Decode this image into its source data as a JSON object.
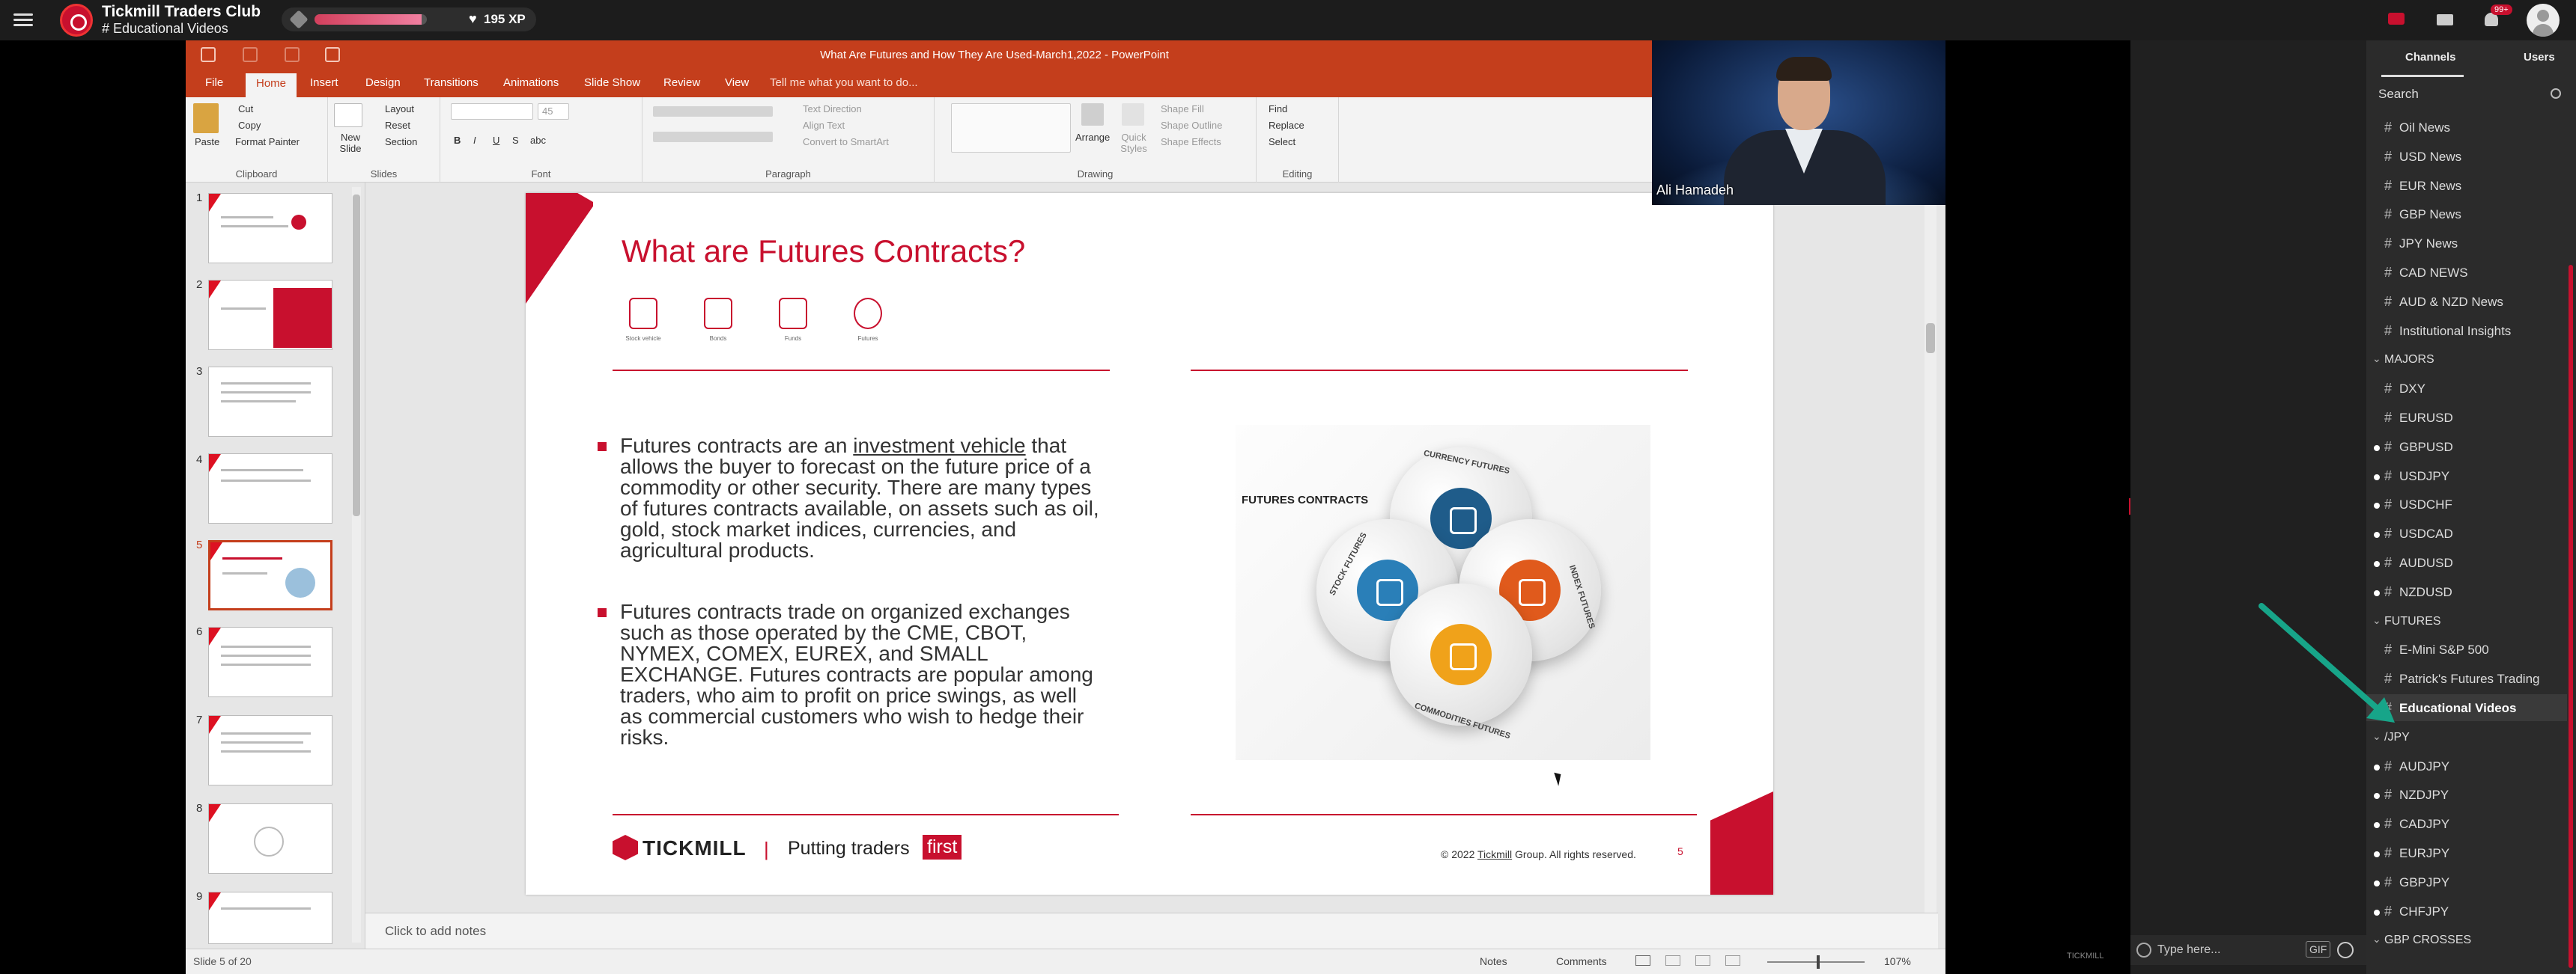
{
  "app": {
    "name": "Tickmill Traders Club",
    "current_channel": "# Educational Videos",
    "xp": "195 XP",
    "xp_progress": 0.95,
    "notification_count": "99+",
    "accent": "#c8102e"
  },
  "powerpoint": {
    "window_title": "What Are Futures and How They Are Used-March1,2022 - PowerPoint",
    "tabs": [
      "File",
      "Home",
      "Insert",
      "Design",
      "Transitions",
      "Animations",
      "Slide Show",
      "Review",
      "View"
    ],
    "tell_me": "Tell me what you want to do...",
    "ribbon": {
      "clipboard": {
        "label": "Clipboard",
        "paste": "Paste",
        "cut": "Cut",
        "copy": "Copy",
        "format_painter": "Format Painter"
      },
      "slides": {
        "label": "Slides",
        "new_slide": "New Slide",
        "layout": "Layout",
        "reset": "Reset",
        "section": "Section"
      },
      "font": {
        "label": "Font",
        "size": "45",
        "bold": "B",
        "italic": "I",
        "underline": "U",
        "strike": "S",
        "shadow": "abc"
      },
      "paragraph": {
        "label": "Paragraph",
        "text_direction": "Text Direction",
        "align_text": "Align Text",
        "convert_smartart": "Convert to SmartArt"
      },
      "drawing": {
        "label": "Drawing",
        "arrange": "Arrange",
        "quick_styles": "Quick Styles",
        "shape_fill": "Shape Fill",
        "shape_outline": "Shape Outline",
        "shape_effects": "Shape Effects"
      },
      "editing": {
        "label": "Editing",
        "find": "Find",
        "replace": "Replace",
        "select": "Select"
      }
    },
    "thumbnails": [
      {
        "num": "1"
      },
      {
        "num": "2"
      },
      {
        "num": "3"
      },
      {
        "num": "4"
      },
      {
        "num": "5",
        "selected": true
      },
      {
        "num": "6"
      },
      {
        "num": "7"
      },
      {
        "num": "8"
      },
      {
        "num": "9"
      }
    ],
    "slide": {
      "title": "What are Futures Contracts?",
      "icons": [
        {
          "name": "stock-vehicle-icon",
          "caption": "Stock vehicle"
        },
        {
          "name": "bonds-icon",
          "caption": "Bonds"
        },
        {
          "name": "funds-icon",
          "caption": "Funds"
        },
        {
          "name": "futures-icon",
          "caption": "Futures"
        }
      ],
      "bullet1": {
        "pre": "Futures contracts are an ",
        "link": "investment vehicle",
        "post": " that allows the buyer to forecast on the future price of a commodity or other security.  There are many types of futures contracts available, on assets such as oil, gold, stock market indices, currencies, and agricultural products."
      },
      "bullet2": "Futures contracts trade on organized exchanges such as those operated by the CME, CBOT, NYMEX, COMEX, EUREX, and SMALL EXCHANGE.  Futures contracts are popular among traders, who aim to profit on price swings, as well as commercial customers who wish to hedge their risks.",
      "figure": {
        "label": "FUTURES CONTRACTS",
        "segments": [
          {
            "name": "CURRENCY FUTURES",
            "color": "#1f5c8a"
          },
          {
            "name": "STOCK FUTURES",
            "color": "#2a7fb8"
          },
          {
            "name": "INDEX FUTURES",
            "color": "#e05a1c"
          },
          {
            "name": "COMMODITIES FUTURES",
            "color": "#f0a21a"
          }
        ]
      },
      "footer": {
        "logo": "TICKMILL",
        "separator": "|",
        "tagline": "Putting traders",
        "tagline_highlight": "first",
        "copyright_pre": "© 2022 ",
        "copyright_link": "Tickmill",
        "copyright_post": " Group. All rights reserved.",
        "page": "5"
      }
    },
    "notes_placeholder": "Click to add notes",
    "status": {
      "slide_indicator": "Slide 5 of 20",
      "notes": "Notes",
      "comments": "Comments",
      "zoom": "107%"
    }
  },
  "webcam": {
    "presenter_name": "Ali Hamadeh"
  },
  "chat": {
    "input_placeholder": "Type here...",
    "gif": "GIF"
  },
  "powered_by": "TICKMILL",
  "sidebar": {
    "tabs": [
      "Channels",
      "Users"
    ],
    "search_placeholder": "Search",
    "rows": [
      {
        "type": "channel",
        "label": "Oil News"
      },
      {
        "type": "channel",
        "label": "USD News"
      },
      {
        "type": "channel",
        "label": "EUR News"
      },
      {
        "type": "channel",
        "label": "GBP News"
      },
      {
        "type": "channel",
        "label": "JPY News"
      },
      {
        "type": "channel",
        "label": "CAD NEWS"
      },
      {
        "type": "channel",
        "label": "AUD & NZD News"
      },
      {
        "type": "channel",
        "label": "Institutional Insights"
      },
      {
        "type": "group",
        "label": "MAJORS"
      },
      {
        "type": "channel",
        "label": "DXY"
      },
      {
        "type": "channel",
        "label": "EURUSD"
      },
      {
        "type": "channel",
        "label": "GBPUSD",
        "unread": true
      },
      {
        "type": "channel",
        "label": "USDJPY",
        "unread": true
      },
      {
        "type": "channel",
        "label": "USDCHF",
        "unread": true
      },
      {
        "type": "channel",
        "label": "USDCAD",
        "unread": true
      },
      {
        "type": "channel",
        "label": "AUDUSD",
        "unread": true
      },
      {
        "type": "channel",
        "label": "NZDUSD",
        "unread": true
      },
      {
        "type": "group",
        "label": "FUTURES"
      },
      {
        "type": "channel",
        "label": "E-Mini S&P 500"
      },
      {
        "type": "channel",
        "label": "Patrick's Futures Trading"
      },
      {
        "type": "channel",
        "label": "Educational Videos",
        "active": true
      },
      {
        "type": "group",
        "label": "/JPY"
      },
      {
        "type": "channel",
        "label": "AUDJPY",
        "unread": true
      },
      {
        "type": "channel",
        "label": "NZDJPY",
        "unread": true
      },
      {
        "type": "channel",
        "label": "CADJPY",
        "unread": true
      },
      {
        "type": "channel",
        "label": "EURJPY",
        "unread": true
      },
      {
        "type": "channel",
        "label": "GBPJPY",
        "unread": true
      },
      {
        "type": "channel",
        "label": "CHFJPY",
        "unread": true
      },
      {
        "type": "group",
        "label": "GBP CROSSES"
      }
    ]
  }
}
